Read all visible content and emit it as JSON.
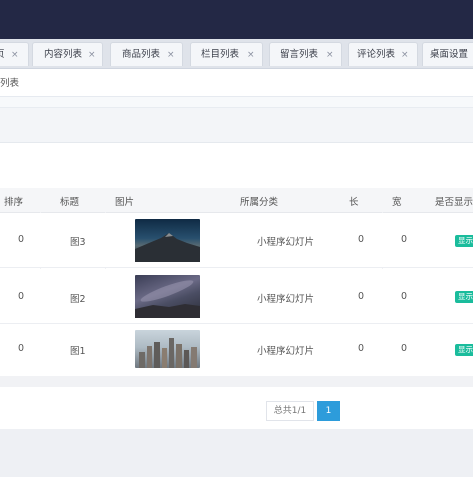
{
  "tabs": [
    {
      "label": "页",
      "close": "×"
    },
    {
      "label": "内容列表",
      "close": "×"
    },
    {
      "label": "商品列表",
      "close": "×"
    },
    {
      "label": "栏目列表",
      "close": "×"
    },
    {
      "label": "留言列表",
      "close": "×"
    },
    {
      "label": "评论列表",
      "close": "×"
    },
    {
      "label": "桌面设置",
      "close": ""
    }
  ],
  "breadcrumb": "列表",
  "table": {
    "headers": [
      "排序",
      "标题",
      "图片",
      "所属分类",
      "长",
      "宽",
      "是否显示"
    ],
    "rows": [
      {
        "sort": "0",
        "title": "图3",
        "image": "mountain-night-photo",
        "category": "小程序幻灯片",
        "length": "0",
        "width": "0",
        "show": "显示"
      },
      {
        "sort": "0",
        "title": "图2",
        "image": "milky-way-photo",
        "category": "小程序幻灯片",
        "length": "0",
        "width": "0",
        "show": "显示"
      },
      {
        "sort": "0",
        "title": "图1",
        "image": "city-skyline-photo",
        "category": "小程序幻灯片",
        "length": "0",
        "width": "0",
        "show": "显示"
      }
    ]
  },
  "pagination": {
    "info": "总共1/1",
    "current": "1"
  },
  "colors": {
    "topbar": "#232845",
    "accent": "#2d9cdb",
    "badge": "#1abc9c"
  }
}
